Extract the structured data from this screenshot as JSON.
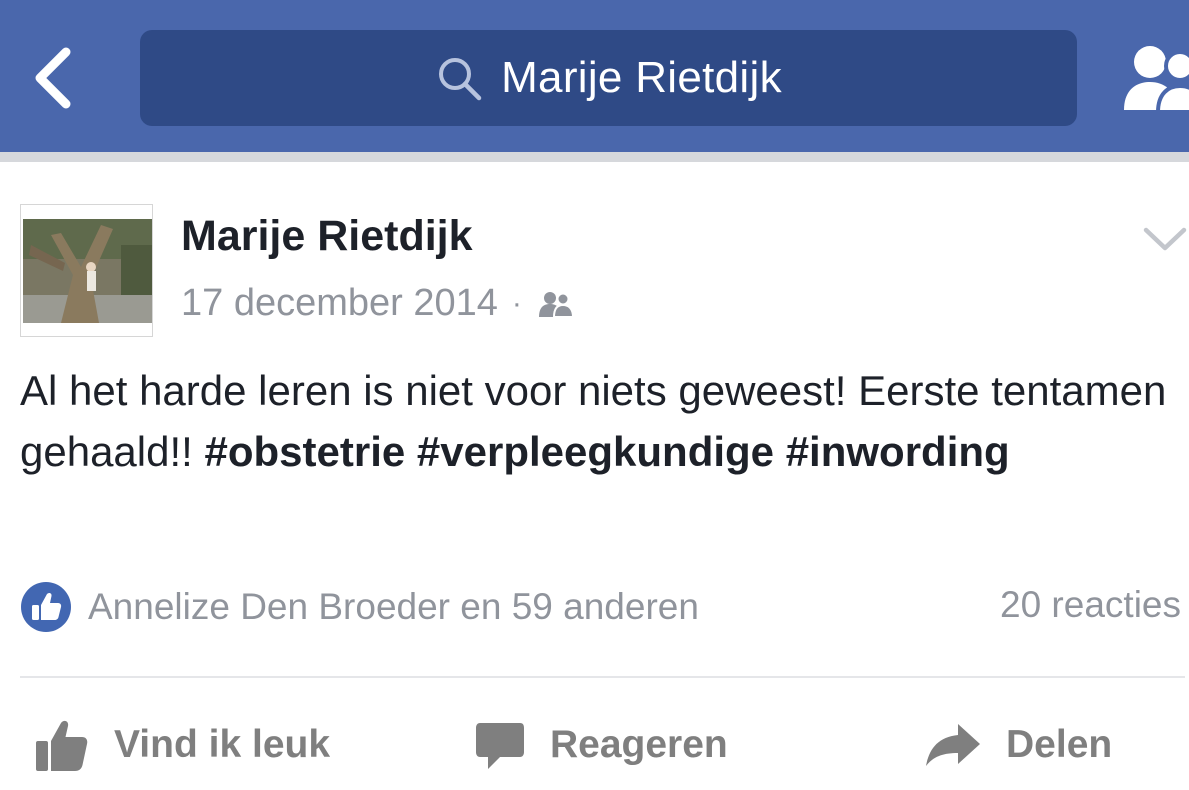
{
  "header": {
    "search_text": "Marije Rietdijk",
    "back_icon": "chevron-left-icon",
    "search_icon": "search-icon",
    "friends_icon": "friend-requests-icon",
    "bar_color": "#4a67ac",
    "search_bg_color": "#2f4a86"
  },
  "post": {
    "author": "Marije Rietdijk",
    "date": "17 december 2014",
    "separator": "·",
    "audience_icon": "friends-audience-icon",
    "text_lead": "Al het harde leren is niet voor niets geweest! Eerste tentamen gehaald!! ",
    "hashtags": [
      "#obstetrie",
      "#verpleegkundige",
      "#inwording"
    ],
    "likes_text": "Annelize Den Broeder en 59 anderen",
    "comments_text": "20 reacties",
    "like_color": "#4267b2"
  },
  "actions": {
    "like_label": "Vind ik leuk",
    "comment_label": "Reageren",
    "share_label": "Delen"
  }
}
